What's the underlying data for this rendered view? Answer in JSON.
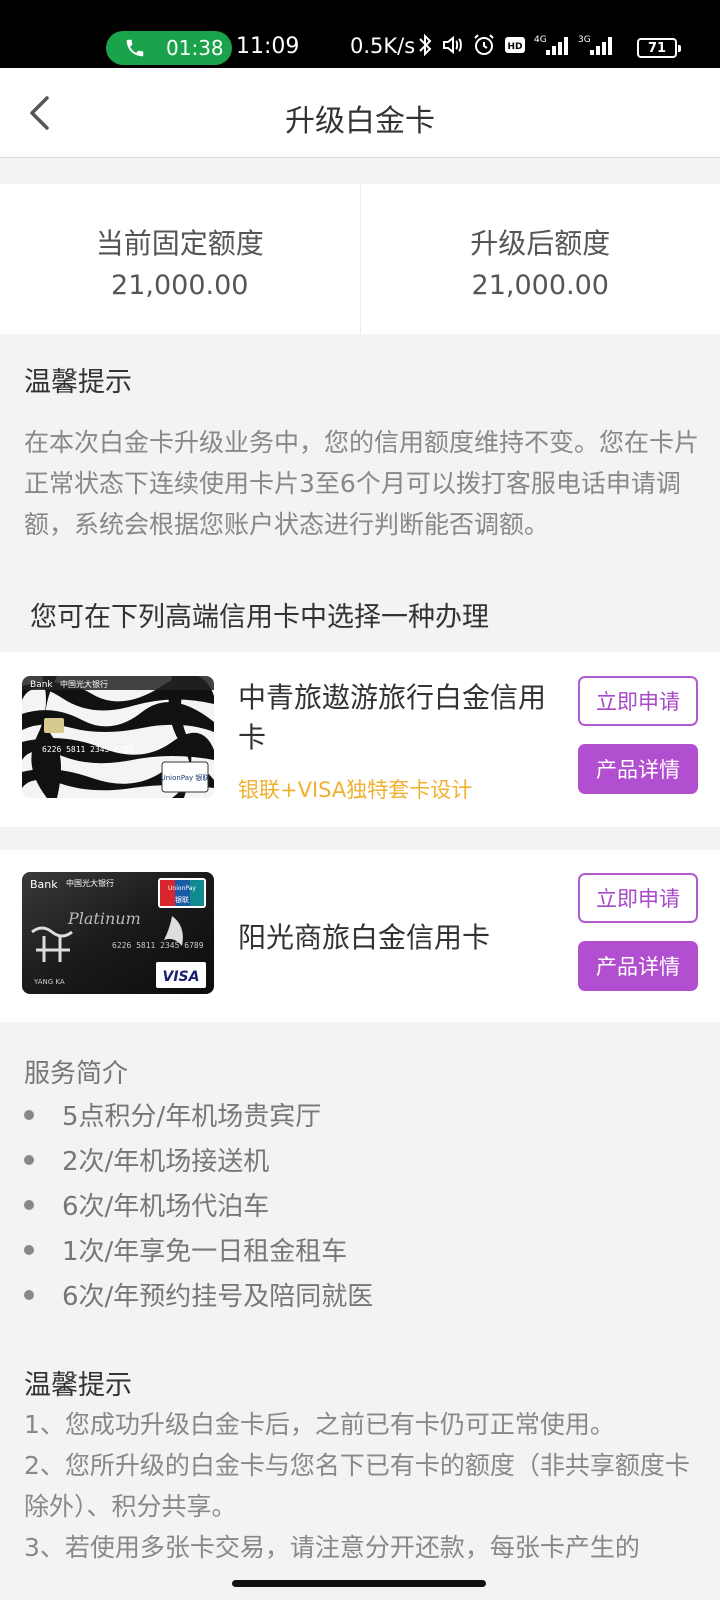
{
  "status_bar": {
    "call_timer": "01:38",
    "time": "11:09",
    "net_speed": "0.5K/s",
    "battery": "71",
    "icons": [
      "phone-icon",
      "bluetooth-icon",
      "vibrate-icon",
      "alarm-icon",
      "hd-icon",
      "4g-signal-icon",
      "3g-signal-icon",
      "battery-icon"
    ],
    "network_labels": {
      "hd": "HD",
      "g4": "4G",
      "g3": "3G"
    }
  },
  "header": {
    "title": "升级白金卡",
    "back_icon": "chevron-left-icon"
  },
  "limits": {
    "current_label": "当前固定额度",
    "current_value": "21,000.00",
    "upgraded_label": "升级后额度",
    "upgraded_value": "21,000.00"
  },
  "notice": {
    "title": "温馨提示",
    "text": "在本次白金卡升级业务中，您的信用额度维持不变。您在卡片正常状态下连续使用卡片3至6个月可以拨打客服电话申请调额，系统会根据您账户状态进行判断能否调额。"
  },
  "choose_title": "您可在下列高端信用卡中选择一种办理",
  "cards": [
    {
      "name": "中青旅遨游旅行白金信用卡",
      "tag": "银联+VISA独特套卡设计",
      "apply_label": "立即申请",
      "detail_label": "产品详情",
      "image_text": {
        "bank": "Bank",
        "bank_cn": "中国光大银行",
        "number": "6226 5811 2345 6789",
        "brand": "UnionPay 银联"
      }
    },
    {
      "name": "阳光商旅白金信用卡",
      "apply_label": "立即申请",
      "detail_label": "产品详情",
      "image_text": {
        "bank": "Bank",
        "bank_cn": "中国光大银行",
        "platinum": "Platinum",
        "number": "6226 5811 2345 6789",
        "holder": "YANG KA",
        "visa": "VISA",
        "unionpay": "UnionPay",
        "unionpay_cn": "银联"
      }
    }
  ],
  "service": {
    "title": "服务简介",
    "items": [
      "5点积分/年机场贵宾厅",
      "2次/年机场接送机",
      "6次/年机场代泊车",
      "1次/年享免一日租金租车",
      "6次/年预约挂号及陪同就医"
    ]
  },
  "notice2": {
    "title": "温馨提示",
    "lines": [
      "1、您成功升级白金卡后，之前已有卡仍可正常使用。",
      "2、您所升级的白金卡与您名下已有卡的额度（非共享额度卡除外）、积分共享。",
      "3、若使用多张卡交易，请注意分开还款，每张卡产生的"
    ]
  },
  "colors": {
    "accent": "#b24fd1",
    "tag": "#f0b030",
    "call": "#1aa34a"
  }
}
